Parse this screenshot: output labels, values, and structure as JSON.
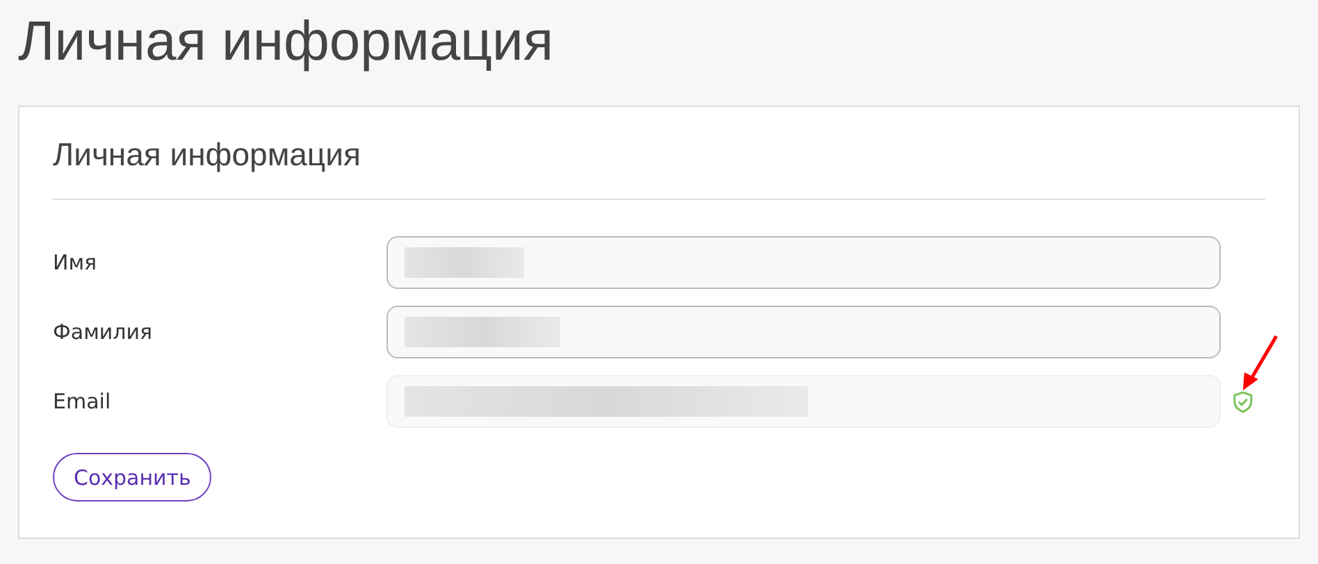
{
  "page_title": "Личная информация",
  "card": {
    "title": "Личная информация",
    "fields": [
      {
        "label": "Имя",
        "disabled": false,
        "redacted": true,
        "verified": false,
        "marked": false
      },
      {
        "label": "Фамилия",
        "disabled": false,
        "redacted": true,
        "verified": false,
        "marked": false
      },
      {
        "label": "Email",
        "disabled": true,
        "redacted": true,
        "verified": true,
        "marked": true
      }
    ],
    "save_button": "Сохранить"
  }
}
